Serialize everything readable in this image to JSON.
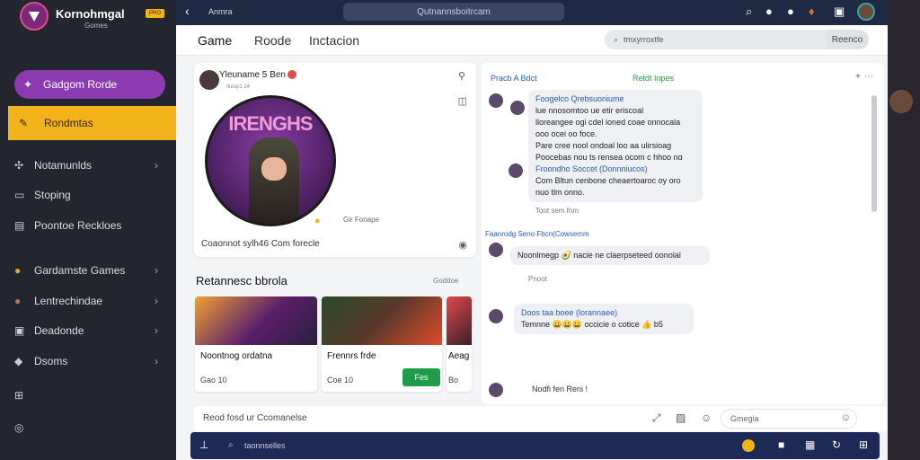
{
  "app": {
    "title": "Kornohmgal",
    "subtitle": "Gomes",
    "badge": "PRO"
  },
  "sidebar": {
    "items": [
      {
        "label": "Gadgom Rorde",
        "icon": "sparkle-icon"
      },
      {
        "label": "Rondmtas",
        "icon": "edit-icon"
      },
      {
        "label": "Notamunlds",
        "icon": "gamepad-icon"
      },
      {
        "label": "Stoping",
        "icon": "cart-icon"
      },
      {
        "label": "Poontoe Reckloes",
        "icon": "book-icon"
      },
      {
        "label": "Gardamste Games",
        "icon": "avatar-icon"
      },
      {
        "label": "Lentrechindae",
        "icon": "avatar-icon"
      },
      {
        "label": "Deadonde",
        "icon": "inbox-icon"
      },
      {
        "label": "Dsoms",
        "icon": "bell-icon"
      }
    ]
  },
  "topbar": {
    "back": "‹",
    "label": "Anmra",
    "search": "Qutnannsboitrcam"
  },
  "main": {
    "tabs": [
      "Game",
      "Roode",
      "Inctacion"
    ],
    "search_placeholder": "tmxyrroxtfe",
    "search_button": "Reenco"
  },
  "post": {
    "author": "Yleuname 5 Ben",
    "meta": "tkesp1 24",
    "image_title": "IRENGHS",
    "side_label": "Gir Fonape",
    "footer": "Coaonnot sylh46   Com forecle"
  },
  "section": {
    "title": "Retannesc bbrola",
    "more": "Goddoe"
  },
  "games": [
    {
      "name": "Noontnog ordatna",
      "meta": "Gao 10"
    },
    {
      "name": "Frennrs frde",
      "meta": "Coe 10",
      "button": "Fes"
    },
    {
      "name": "Aeag",
      "meta": "Bo"
    }
  ],
  "chat": {
    "tabs": [
      "Pracb  A Bdct",
      "Retdt  Inpes"
    ],
    "messages": [
      {
        "lines": [
          "Foogelco  Qrebsuoniume",
          "lue nnosomtoo ue etir eriscoal",
          "lloreangee ogi cdel ioned coae onnocala",
          "ooo ocei oo foce.",
          "Pare cree nool ondoal loo aa ulirsioag",
          "Poocebas nou ts rensea ocom c hhoo ng"
        ]
      },
      {
        "lines": [
          "Froondho Soccet  (Donnniucos)",
          "Com Bltun cenbone cheaertoaroc oy oro",
          "nuo tlm onno."
        ]
      },
      {
        "time": "Toot sem fnm"
      },
      {
        "lines": [
          "Faanrodg Seno  Fbcn(Cowsemm"
        ]
      },
      {
        "lines": [
          "Noonlmegp 🥑 nacie ne claerpseteed oonolal"
        ]
      },
      {
        "time": "Pnoot"
      },
      {
        "lines": [
          "Doos taa  boee  (lorannaee)",
          "Temnne 😀😀😀 occicie o cotice 👍 b5"
        ]
      },
      {
        "lines": [
          "Nodfi fen Reni !"
        ]
      }
    ]
  },
  "comment": {
    "label": "Reod fosd ur Ccomanelse",
    "placeholder": "Gmegia"
  },
  "bottom": {
    "placeholder": "taonnselles"
  },
  "colors": {
    "accent_purple": "#8b3ab0",
    "accent_yellow": "#f2b21a",
    "play_green": "#1f9d46",
    "nav_dark": "#1e2a56"
  }
}
